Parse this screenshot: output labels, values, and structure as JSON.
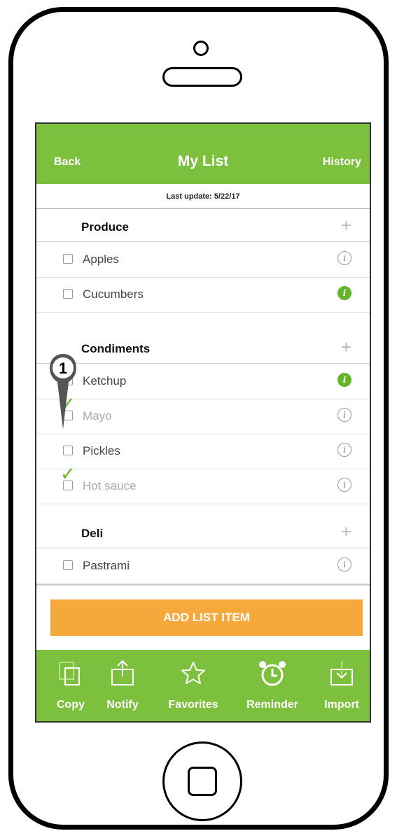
{
  "nav": {
    "back": "Back",
    "title": "My List",
    "history": "History"
  },
  "last_update": "Last update: 5/22/17",
  "sections": [
    {
      "title": "Produce",
      "items": [
        {
          "label": "Apples",
          "checked": false,
          "info_active": false
        },
        {
          "label": "Cucumbers",
          "checked": false,
          "info_active": true
        }
      ]
    },
    {
      "title": "Condiments",
      "items": [
        {
          "label": "Ketchup",
          "checked": false,
          "info_active": true
        },
        {
          "label": "Mayo",
          "checked": true,
          "info_active": false
        },
        {
          "label": "Pickles",
          "checked": false,
          "info_active": false
        },
        {
          "label": "Hot sauce",
          "checked": true,
          "info_active": false
        }
      ]
    },
    {
      "title": "Deli",
      "items": [
        {
          "label": "Pastrami",
          "checked": false,
          "info_active": false
        }
      ]
    }
  ],
  "add_button": "ADD LIST ITEM",
  "toolbar": [
    {
      "label": "Copy",
      "icon": "copy-icon"
    },
    {
      "label": "Notify",
      "icon": "share-icon"
    },
    {
      "label": "Favorites",
      "icon": "star-icon"
    },
    {
      "label": "Reminder",
      "icon": "alarm-clock-icon"
    },
    {
      "label": "Import",
      "icon": "import-icon"
    }
  ],
  "annotation_marker": "1",
  "colors": {
    "primary": "#7cc03e",
    "accent": "#f5a93d",
    "check": "#63b52c"
  }
}
